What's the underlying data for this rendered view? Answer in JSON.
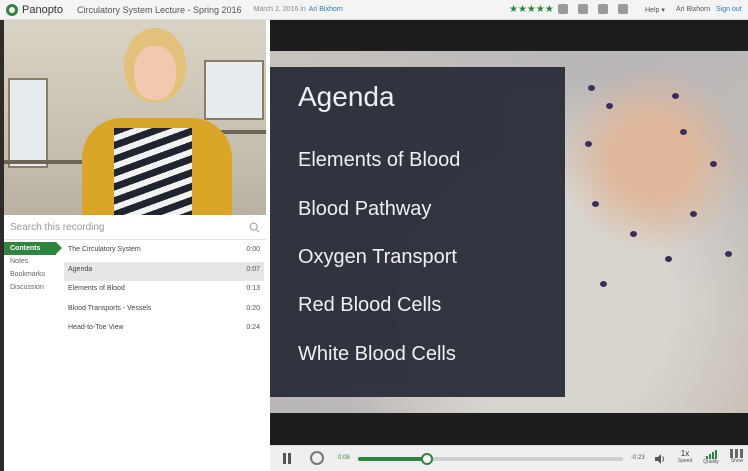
{
  "app": {
    "logo_text": "Panopto"
  },
  "session": {
    "title": "Circulatory System Lecture - Spring 2016",
    "date": "March 2, 2016 in",
    "author": "Ari Bixhorn"
  },
  "rating": {
    "stars": 5,
    "star_glyph": "★★★★★"
  },
  "header": {
    "help_label": "Help ▾",
    "user_name": "Ari Bixhorn",
    "signout_label": "Sign out"
  },
  "search": {
    "placeholder": "Search this recording"
  },
  "tabs": [
    {
      "label": "Contents",
      "active": true
    },
    {
      "label": "Notes"
    },
    {
      "label": "Bookmarks"
    },
    {
      "label": "Discussion"
    }
  ],
  "contents": [
    {
      "title": "The Circulatory System",
      "time": "0:00"
    },
    {
      "title": "Agenda",
      "time": "0:07",
      "selected": true
    },
    {
      "title": "Elements of Blood",
      "time": "0:13"
    },
    {
      "title": "Blood Transports - Vessels",
      "time": "0:20"
    },
    {
      "title": "Head-to-Toe View",
      "time": "0:24"
    }
  ],
  "slide": {
    "title": "Agenda",
    "items": [
      "Elements of Blood",
      "Blood Pathway",
      "Oxygen Transport",
      "Red Blood Cells",
      "White Blood Cells"
    ]
  },
  "player": {
    "elapsed": "0:08",
    "remaining": "-0:23",
    "progress_fraction": 0.26,
    "speed_value": "1x",
    "speed_label": "Speed",
    "quality_label": "Quality",
    "show_label": "Show"
  },
  "colors": {
    "accent": "#2e8540",
    "link": "#2a7ab8",
    "slide_panel": "#2b2f3a"
  }
}
